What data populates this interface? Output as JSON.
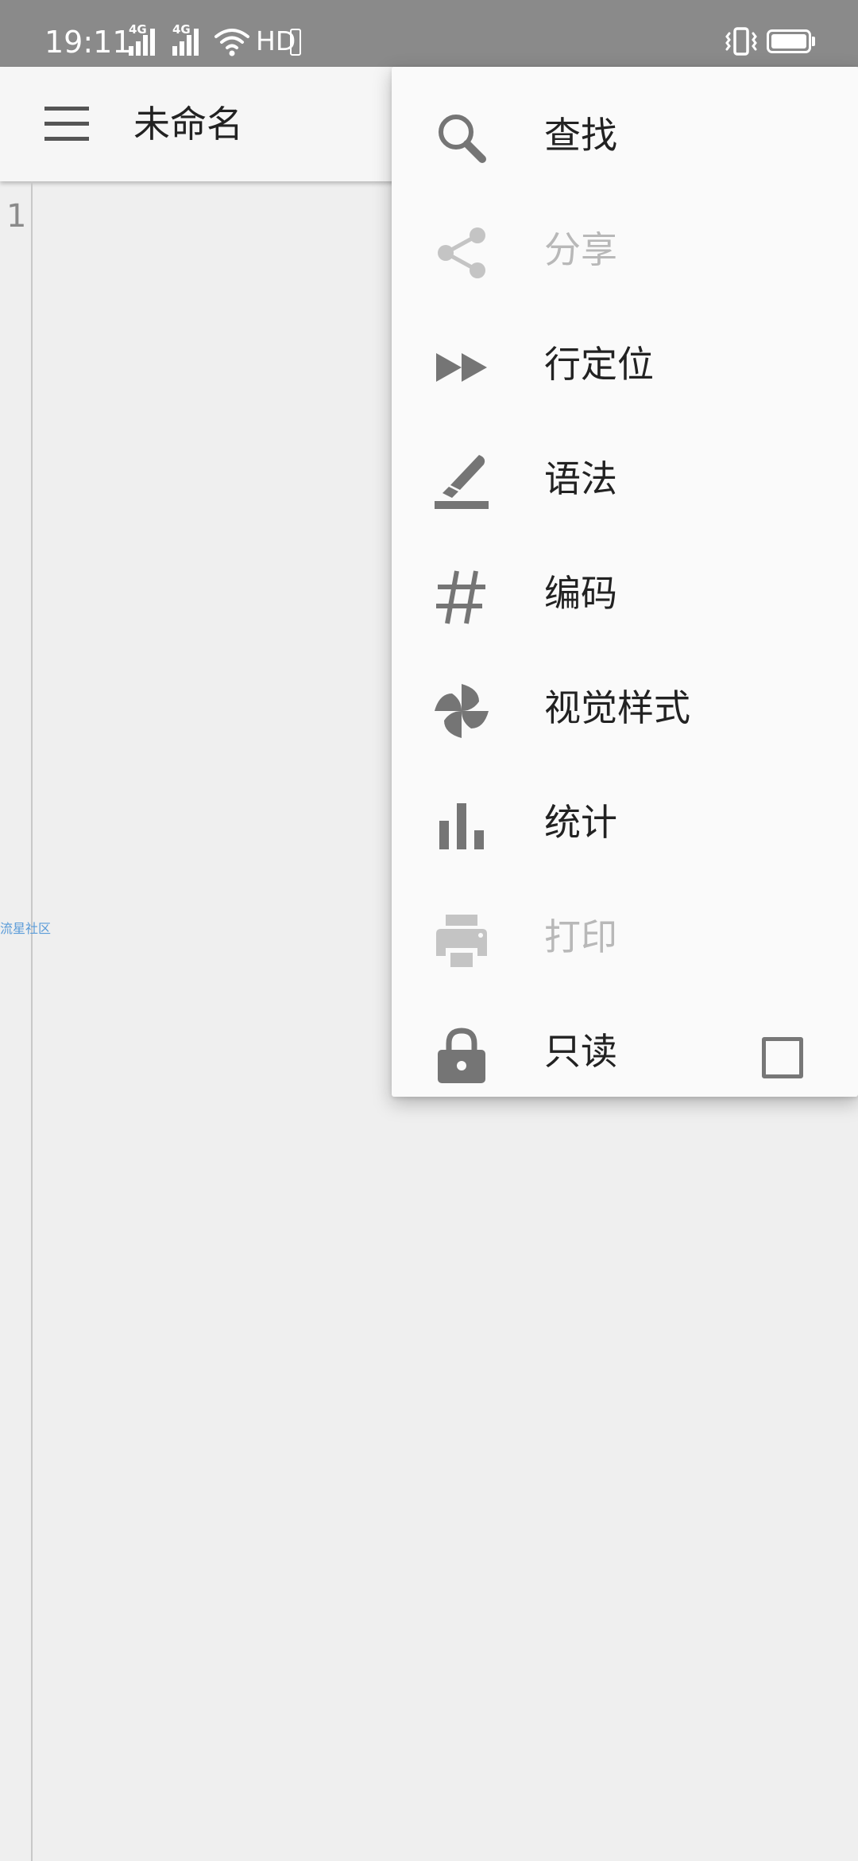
{
  "status_bar": {
    "time": "19:11",
    "network1": "4G",
    "network2": "4G",
    "hd": "HD"
  },
  "app_bar": {
    "title": "未命名"
  },
  "editor": {
    "line_number": "1",
    "watermark": "流星社区"
  },
  "menu": {
    "items": [
      {
        "label": "查找",
        "icon": "search-icon",
        "enabled": true
      },
      {
        "label": "分享",
        "icon": "share-icon",
        "enabled": false
      },
      {
        "label": "行定位",
        "icon": "fast-forward-icon",
        "enabled": true
      },
      {
        "label": "语法",
        "icon": "highlighter-icon",
        "enabled": true
      },
      {
        "label": "编码",
        "icon": "hash-icon",
        "enabled": true
      },
      {
        "label": "视觉样式",
        "icon": "pinwheel-icon",
        "enabled": true
      },
      {
        "label": "统计",
        "icon": "bar-chart-icon",
        "enabled": true
      },
      {
        "label": "打印",
        "icon": "printer-icon",
        "enabled": false
      },
      {
        "label": "只读",
        "icon": "lock-icon",
        "enabled": true,
        "checked": false
      }
    ]
  },
  "colors": {
    "status_bar_bg": "#8a8a8a",
    "icon_enabled": "#757575",
    "icon_disabled": "#c4c4c4",
    "text_disabled": "#b8b8b8",
    "watermark": "#5a9bd8"
  }
}
